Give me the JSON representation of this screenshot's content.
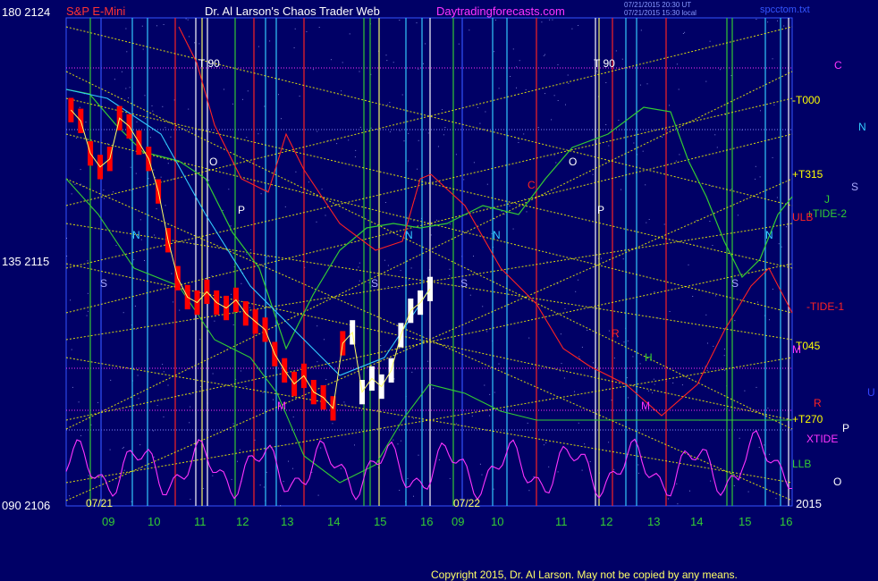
{
  "header": {
    "instrument": "S&P E-Mini",
    "title": "Dr. Al Larson's Chaos Trader Web",
    "site": "Daytradingforecasts.com",
    "timestamp_1": "07/21/2015 20:30 UT",
    "timestamp_2": "07/21/2015 15:30 local",
    "file": "spcctom.txt"
  },
  "y_axis": {
    "top": "180  2124",
    "mid": "135  2115",
    "bottom": "090  2106"
  },
  "x_axis": {
    "day1_date": "07/21",
    "day2_date": "07/22",
    "year": "2015",
    "day1_hours": [
      "09",
      "10",
      "11",
      "12",
      "13",
      "14",
      "15",
      "16"
    ],
    "day2_hours": [
      "09",
      "10",
      "11",
      "12",
      "13",
      "14",
      "15",
      "16"
    ]
  },
  "right_labels": [
    {
      "text": "C",
      "color": "#ff33ff"
    },
    {
      "text": "-T000",
      "color": "#ffff00"
    },
    {
      "text": "N",
      "color": "#33ccff"
    },
    {
      "text": "+T315",
      "color": "#ffff00"
    },
    {
      "text": "S",
      "color": "#aaaaff"
    },
    {
      "text": "J",
      "color": "#33cc33"
    },
    {
      "text": "+TIDE-2",
      "color": "#33cc33"
    },
    {
      "text": "ULB",
      "color": "#ff2222"
    },
    {
      "text": "-TIDE-1",
      "color": "#ff2222"
    },
    {
      "text": "T045",
      "color": "#ffff00"
    },
    {
      "text": "M",
      "color": "#ff33ff"
    },
    {
      "text": "U",
      "color": "#3344ff"
    },
    {
      "text": "R",
      "color": "#ff2222"
    },
    {
      "text": "+T270",
      "color": "#ffff00"
    },
    {
      "text": "P",
      "color": "#ffffff"
    },
    {
      "text": "XTIDE",
      "color": "#ff33ff"
    },
    {
      "text": "LLB",
      "color": "#33cc33"
    },
    {
      "text": "O",
      "color": "#ffffff"
    }
  ],
  "plot_labels": {
    "t90_a": "T  90",
    "t90_b": "T  90",
    "o_a": "O",
    "o_b": "O",
    "p_a": "P",
    "p_b": "P",
    "n_a": "N",
    "n_b": "N",
    "n_c": "N",
    "n_d": "N",
    "s_a": "S",
    "s_b": "S",
    "s_c": "S",
    "s_d": "S",
    "c_a": "C",
    "r_a": "R",
    "h_a": "H",
    "m_a": "M",
    "m_b": "M"
  },
  "copyright": "Copyright 2015, Dr. Al Larson. May not be copied by any means.",
  "colors": {
    "background": "#000066",
    "price_bar": "#ff0000",
    "price_bar_today": "#ffffff",
    "forecast_yellow": "#ffff00",
    "cyan": "#33ccff",
    "green": "#33cc33",
    "red": "#ff2222",
    "magenta": "#ff33ff",
    "gridline": "#8888ff"
  },
  "chart_data": {
    "type": "line",
    "title": "S&P E-Mini",
    "y_scale_left": {
      "labels": [
        "2124",
        "2115",
        "2106"
      ],
      "degrees": [
        "180",
        "135",
        "090"
      ]
    },
    "ylim": [
      2106,
      2124
    ],
    "x_days": [
      "07/21",
      "07/22"
    ],
    "x_hours": [
      "09",
      "10",
      "11",
      "12",
      "13",
      "14",
      "15",
      "16"
    ],
    "price_series_day1": {
      "name": "",
      "hours": [
        8.6,
        8.8,
        9.0,
        9.2,
        9.4,
        9.6,
        9.8,
        10.0,
        10.2,
        10.4,
        10.6,
        10.8,
        11.0,
        11.2,
        11.4,
        11.6,
        11.8,
        12.0,
        12.2,
        12.4,
        12.6,
        12.8,
        13.0,
        13.2,
        13.4,
        13.6,
        13.8,
        14.0,
        14.2,
        14.4,
        14.6,
        14.8,
        15.0,
        15.2,
        15.4,
        15.6,
        15.8,
        16.0
      ],
      "values": [
        2120.6,
        2120.2,
        2119.0,
        2118.5,
        2118.8,
        2120.3,
        2120.0,
        2119.4,
        2118.8,
        2117.6,
        2115.8,
        2114.4,
        2113.7,
        2113.5,
        2113.9,
        2113.5,
        2113.3,
        2113.6,
        2113.1,
        2112.8,
        2112.5,
        2111.6,
        2111.0,
        2110.5,
        2110.8,
        2110.2,
        2110.0,
        2109.6,
        2112.0,
        2112.4,
        2110.2,
        2110.7,
        2110.4,
        2111.0,
        2112.3,
        2113.2,
        2113.5,
        2114.0
      ]
    },
    "grid": true,
    "legend": "right"
  }
}
